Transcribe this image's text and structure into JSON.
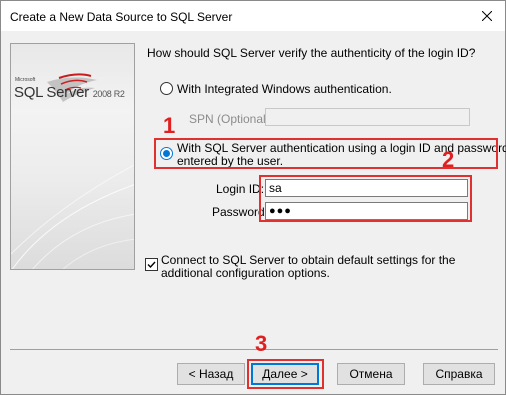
{
  "window": {
    "title": "Create a New Data Source to SQL Server"
  },
  "logo": {
    "brand_small": "Microsoft",
    "product": "SQL Server",
    "version": "2008 R2"
  },
  "question": "How should SQL Server verify the authenticity of the login ID?",
  "auth": {
    "windows_label": "With Integrated Windows authentication.",
    "spn_label": "SPN (Optional):",
    "spn_value": "",
    "sql_label_line1": "With SQL Server authentication using a login ID and password",
    "sql_label_line2": "entered by the user.",
    "selected": "sql"
  },
  "credentials": {
    "login_label": "Login ID:",
    "login_value": "sa",
    "password_label": "Password:",
    "password_value": "●●●"
  },
  "connect_option": {
    "checked": true,
    "line1": "Connect to SQL Server to obtain default settings for the",
    "line2": "additional configuration options."
  },
  "buttons": {
    "back": "< Назад",
    "next": "Далее >",
    "cancel": "Отмена",
    "help": "Справка"
  },
  "annotations": {
    "step1": "1",
    "step2": "2",
    "step3": "3",
    "color": "#e03030"
  }
}
